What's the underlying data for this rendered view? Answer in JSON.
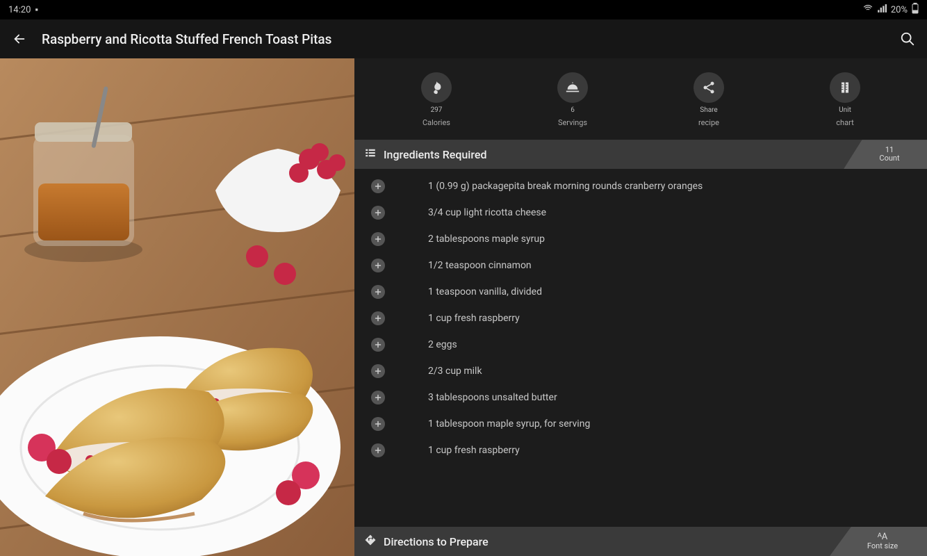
{
  "status": {
    "time": "14:20",
    "battery": "20%"
  },
  "header": {
    "title": "Raspberry and Ricotta Stuffed French Toast Pitas"
  },
  "metrics": {
    "calories": {
      "value": "297",
      "label": "Calories"
    },
    "servings": {
      "value": "6",
      "label": "Servings"
    },
    "share": {
      "value": "Share",
      "label": "recipe"
    },
    "unit": {
      "value": "Unit",
      "label": "chart"
    }
  },
  "sections": {
    "ingredients_title": "Ingredients Required",
    "ingredients_count_value": "11",
    "ingredients_count_label": "Count",
    "directions_title": "Directions to Prepare",
    "fontsize_label": "Font size"
  },
  "ingredients": [
    "1 (0.99 g) packagepita break morning rounds cranberry oranges",
    "3/4 cup light ricotta cheese",
    "2 tablespoons maple syrup",
    "1/2 teaspoon cinnamon",
    "1 teaspoon vanilla, divided",
    "1 cup fresh raspberry",
    "2 eggs",
    "2/3 cup milk",
    "3 tablespoons unsalted butter",
    "1 tablespoon maple syrup, for serving",
    "1 cup fresh raspberry"
  ],
  "icons": {
    "fontsize_glyph": "ᴬA"
  }
}
